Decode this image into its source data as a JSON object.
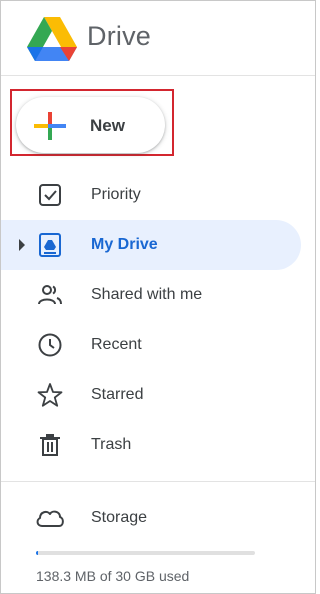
{
  "app": {
    "title": "Drive",
    "logo_icon": "google-drive-logo"
  },
  "new_button": {
    "label": "New",
    "icon": "google-plus-icon",
    "highlight_color": "#d3262f"
  },
  "nav": {
    "items": [
      {
        "label": "Priority",
        "icon": "priority-checkbox-icon",
        "active": false
      },
      {
        "label": "My Drive",
        "icon": "my-drive-icon",
        "active": true,
        "expandable": true
      },
      {
        "label": "Shared with me",
        "icon": "people-icon",
        "active": false
      },
      {
        "label": "Recent",
        "icon": "clock-icon",
        "active": false
      },
      {
        "label": "Starred",
        "icon": "star-icon",
        "active": false
      },
      {
        "label": "Trash",
        "icon": "trash-icon",
        "active": false
      }
    ]
  },
  "storage": {
    "label": "Storage",
    "icon": "cloud-icon",
    "usage_text": "138.3 MB of 30 GB used",
    "used_fraction": 0.0045
  },
  "colors": {
    "accent": "#1967d2",
    "active_bg": "#e8f0fe",
    "brand_blue": "#4285f4",
    "brand_red": "#ea4335",
    "brand_yellow": "#fbbc04",
    "brand_green": "#34a853"
  }
}
